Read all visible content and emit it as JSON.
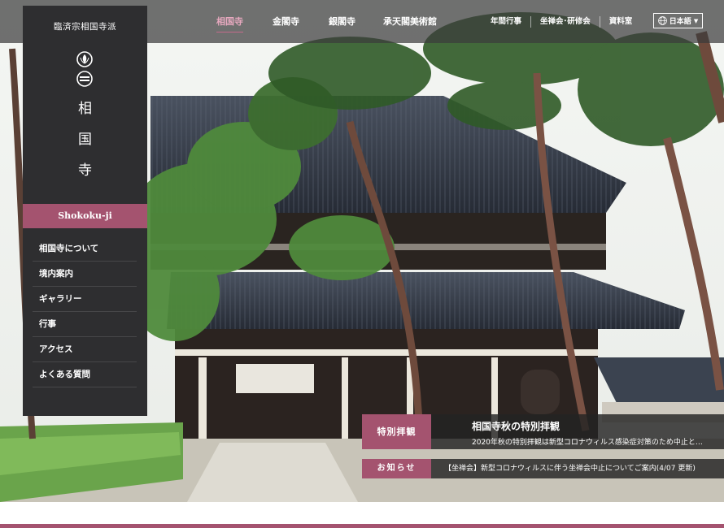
{
  "nav": {
    "main_links": [
      "相国寺",
      "金閣寺",
      "銀閣寺",
      "承天閣美術館"
    ],
    "sub_links": [
      "年間行事",
      "坐禅会･研修会",
      "資料室"
    ],
    "language": "日本語",
    "accent_color": "#a4536f",
    "active_link_color": "#e7a9bf"
  },
  "sidebar": {
    "lineage": "臨済宗相国寺派",
    "temple_name": [
      "相",
      "国",
      "寺"
    ],
    "romaji": "Shokoku-ji",
    "menu": [
      "相国寺について",
      "境内案内",
      "ギャラリー",
      "行事",
      "アクセス",
      "よくある質問"
    ]
  },
  "news": {
    "featured": {
      "tag": "特別拝観",
      "title": "相国寺秋の特別拝観",
      "excerpt": "2020年秋の特別拝観は新型コロナウィルス感染症対策のため中止と…"
    },
    "notice": {
      "tag": "お知らせ",
      "text": "【坐禅会】新型コロナウィルスに伴う坐禅会中止についてご案内(4/07 更新)"
    }
  }
}
